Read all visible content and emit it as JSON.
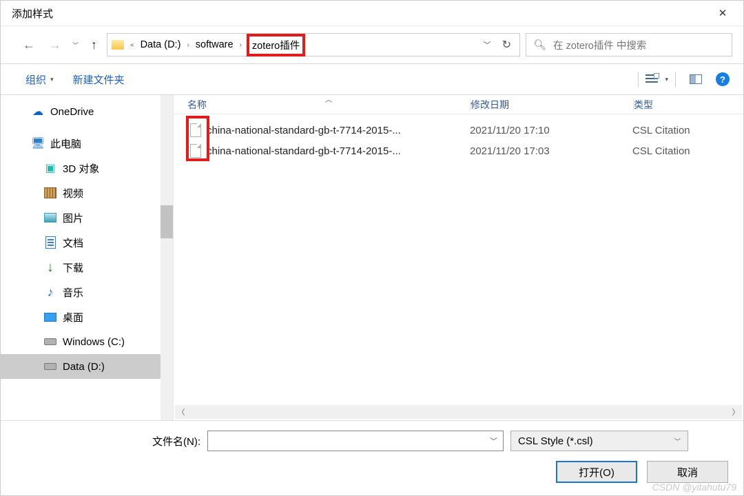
{
  "title": "添加样式",
  "breadcrumb": {
    "segments": [
      "Data (D:)",
      "software",
      "zotero插件"
    ],
    "highlight_index": 2
  },
  "search": {
    "placeholder": "在 zotero插件 中搜索"
  },
  "toolbar": {
    "organize": "组织",
    "new_folder": "新建文件夹"
  },
  "sidebar": {
    "onedrive": "OneDrive",
    "this_pc": "此电脑",
    "items": [
      {
        "icon": "3d",
        "label": "3D 对象"
      },
      {
        "icon": "video",
        "label": "视频"
      },
      {
        "icon": "picture",
        "label": "图片"
      },
      {
        "icon": "document",
        "label": "文档"
      },
      {
        "icon": "download",
        "label": "下载"
      },
      {
        "icon": "music",
        "label": "音乐"
      },
      {
        "icon": "desktop",
        "label": "桌面"
      },
      {
        "icon": "drive",
        "label": "Windows (C:)"
      },
      {
        "icon": "drive",
        "label": "Data (D:)"
      }
    ],
    "selected_index": 8
  },
  "columns": {
    "name": "名称",
    "date": "修改日期",
    "type": "类型"
  },
  "files": [
    {
      "name": "china-national-standard-gb-t-7714-2015-...",
      "date": "2021/11/20 17:10",
      "type": "CSL Citation"
    },
    {
      "name": "china-national-standard-gb-t-7714-2015-...",
      "date": "2021/11/20 17:03",
      "type": "CSL Citation"
    }
  ],
  "bottom": {
    "filename_label": "文件名(N):",
    "filename_value": "",
    "filetype": "CSL Style (*.csl)",
    "open": "打开(O)",
    "cancel": "取消"
  },
  "watermark": "CSDN @yitahutu79"
}
